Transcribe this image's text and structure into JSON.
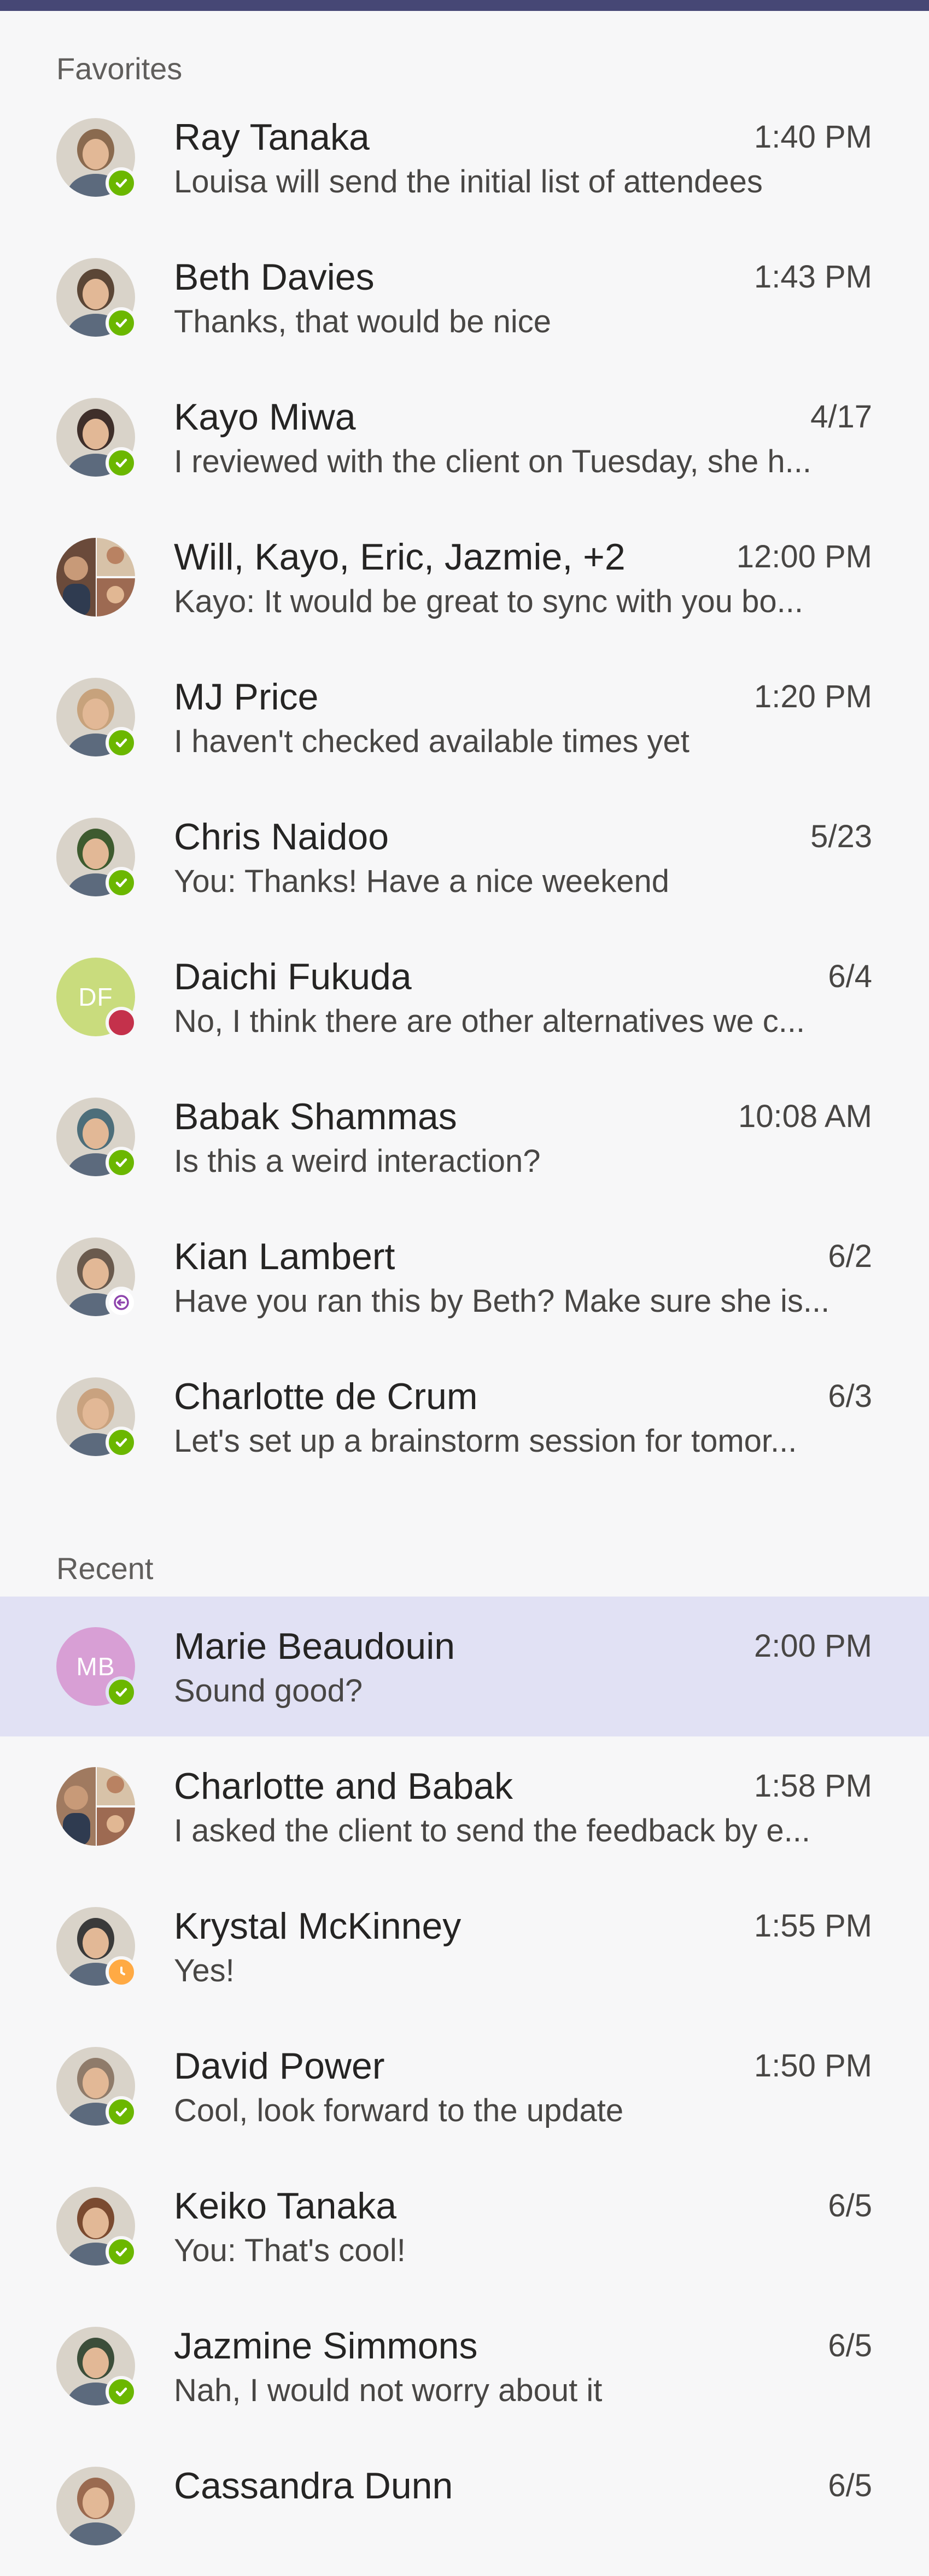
{
  "sections": [
    {
      "title": "Favorites",
      "items": [
        {
          "name": "Ray Tanaka",
          "time": "1:40 PM",
          "preview": "Louisa will send the initial list of attendees",
          "status": "available",
          "avatar_color": "#8a6a4f"
        },
        {
          "name": "Beth Davies",
          "time": "1:43 PM",
          "preview": "Thanks, that would be nice",
          "status": "available",
          "avatar_color": "#5b4636"
        },
        {
          "name": "Kayo Miwa",
          "time": "4/17",
          "preview": "I reviewed with the client on Tuesday, she h...",
          "status": "available",
          "avatar_color": "#3f2f2a"
        },
        {
          "name": "Will, Kayo, Eric, Jazmie, +2",
          "time": "12:00 PM",
          "preview": "Kayo: It would be great to sync with you bo...",
          "status": "group",
          "avatar_color": "#6a4a3a"
        },
        {
          "name": "MJ Price",
          "time": "1:20 PM",
          "preview": "I haven't checked available times yet",
          "status": "available",
          "avatar_color": "#c7a27c"
        },
        {
          "name": "Chris Naidoo",
          "time": "5/23",
          "preview": "You: Thanks! Have a nice weekend",
          "status": "available",
          "avatar_color": "#3e5b2f"
        },
        {
          "name": "Daichi Fukuda",
          "time": "6/4",
          "preview": "No, I think there are other alternatives we c...",
          "status": "busy",
          "initials": "DF",
          "avatar_color": "#c9dc7d"
        },
        {
          "name": "Babak Shammas",
          "time": "10:08 AM",
          "preview": "Is this a weird interaction?",
          "status": "available",
          "avatar_color": "#4d6e7a"
        },
        {
          "name": "Kian Lambert",
          "time": "6/2",
          "preview": "Have you ran this by Beth? Make sure she is...",
          "status": "away-out",
          "avatar_color": "#6a5a4d"
        },
        {
          "name": "Charlotte de Crum",
          "time": "6/3",
          "preview": "Let's set up a brainstorm session for tomor...",
          "status": "available",
          "avatar_color": "#c9a27f"
        }
      ]
    },
    {
      "title": "Recent",
      "items": [
        {
          "name": "Marie Beaudouin",
          "time": "2:00 PM",
          "preview": "Sound good?",
          "status": "available",
          "initials": "MB",
          "avatar_color": "#d89fd5",
          "selected": true
        },
        {
          "name": "Charlotte and Babak",
          "time": "1:58 PM",
          "preview": "I asked the client to send the feedback by e...",
          "status": "group",
          "avatar_color": "#a07a60"
        },
        {
          "name": "Krystal McKinney",
          "time": "1:55 PM",
          "preview": "Yes!",
          "status": "away",
          "avatar_color": "#3a3a3a"
        },
        {
          "name": "David Power",
          "time": "1:50 PM",
          "preview": "Cool, look forward to the update",
          "status": "available",
          "avatar_color": "#8f7b6a"
        },
        {
          "name": "Keiko Tanaka",
          "time": "6/5",
          "preview": "You: That's cool!",
          "status": "available",
          "avatar_color": "#7a4a30"
        },
        {
          "name": "Jazmine Simmons",
          "time": "6/5",
          "preview": "Nah, I would not worry about it",
          "status": "available",
          "avatar_color": "#3c4e3a"
        },
        {
          "name": "Cassandra Dunn",
          "time": "6/5",
          "preview": "",
          "status": "none",
          "avatar_color": "#9a6a50"
        }
      ]
    }
  ],
  "colors": {
    "available": "#6bb700",
    "busy": "#c4314b",
    "away": "#ffaa44",
    "away-out": "#8e44ad",
    "selected_bg": "#e1e1f4",
    "topbar": "#464775"
  }
}
